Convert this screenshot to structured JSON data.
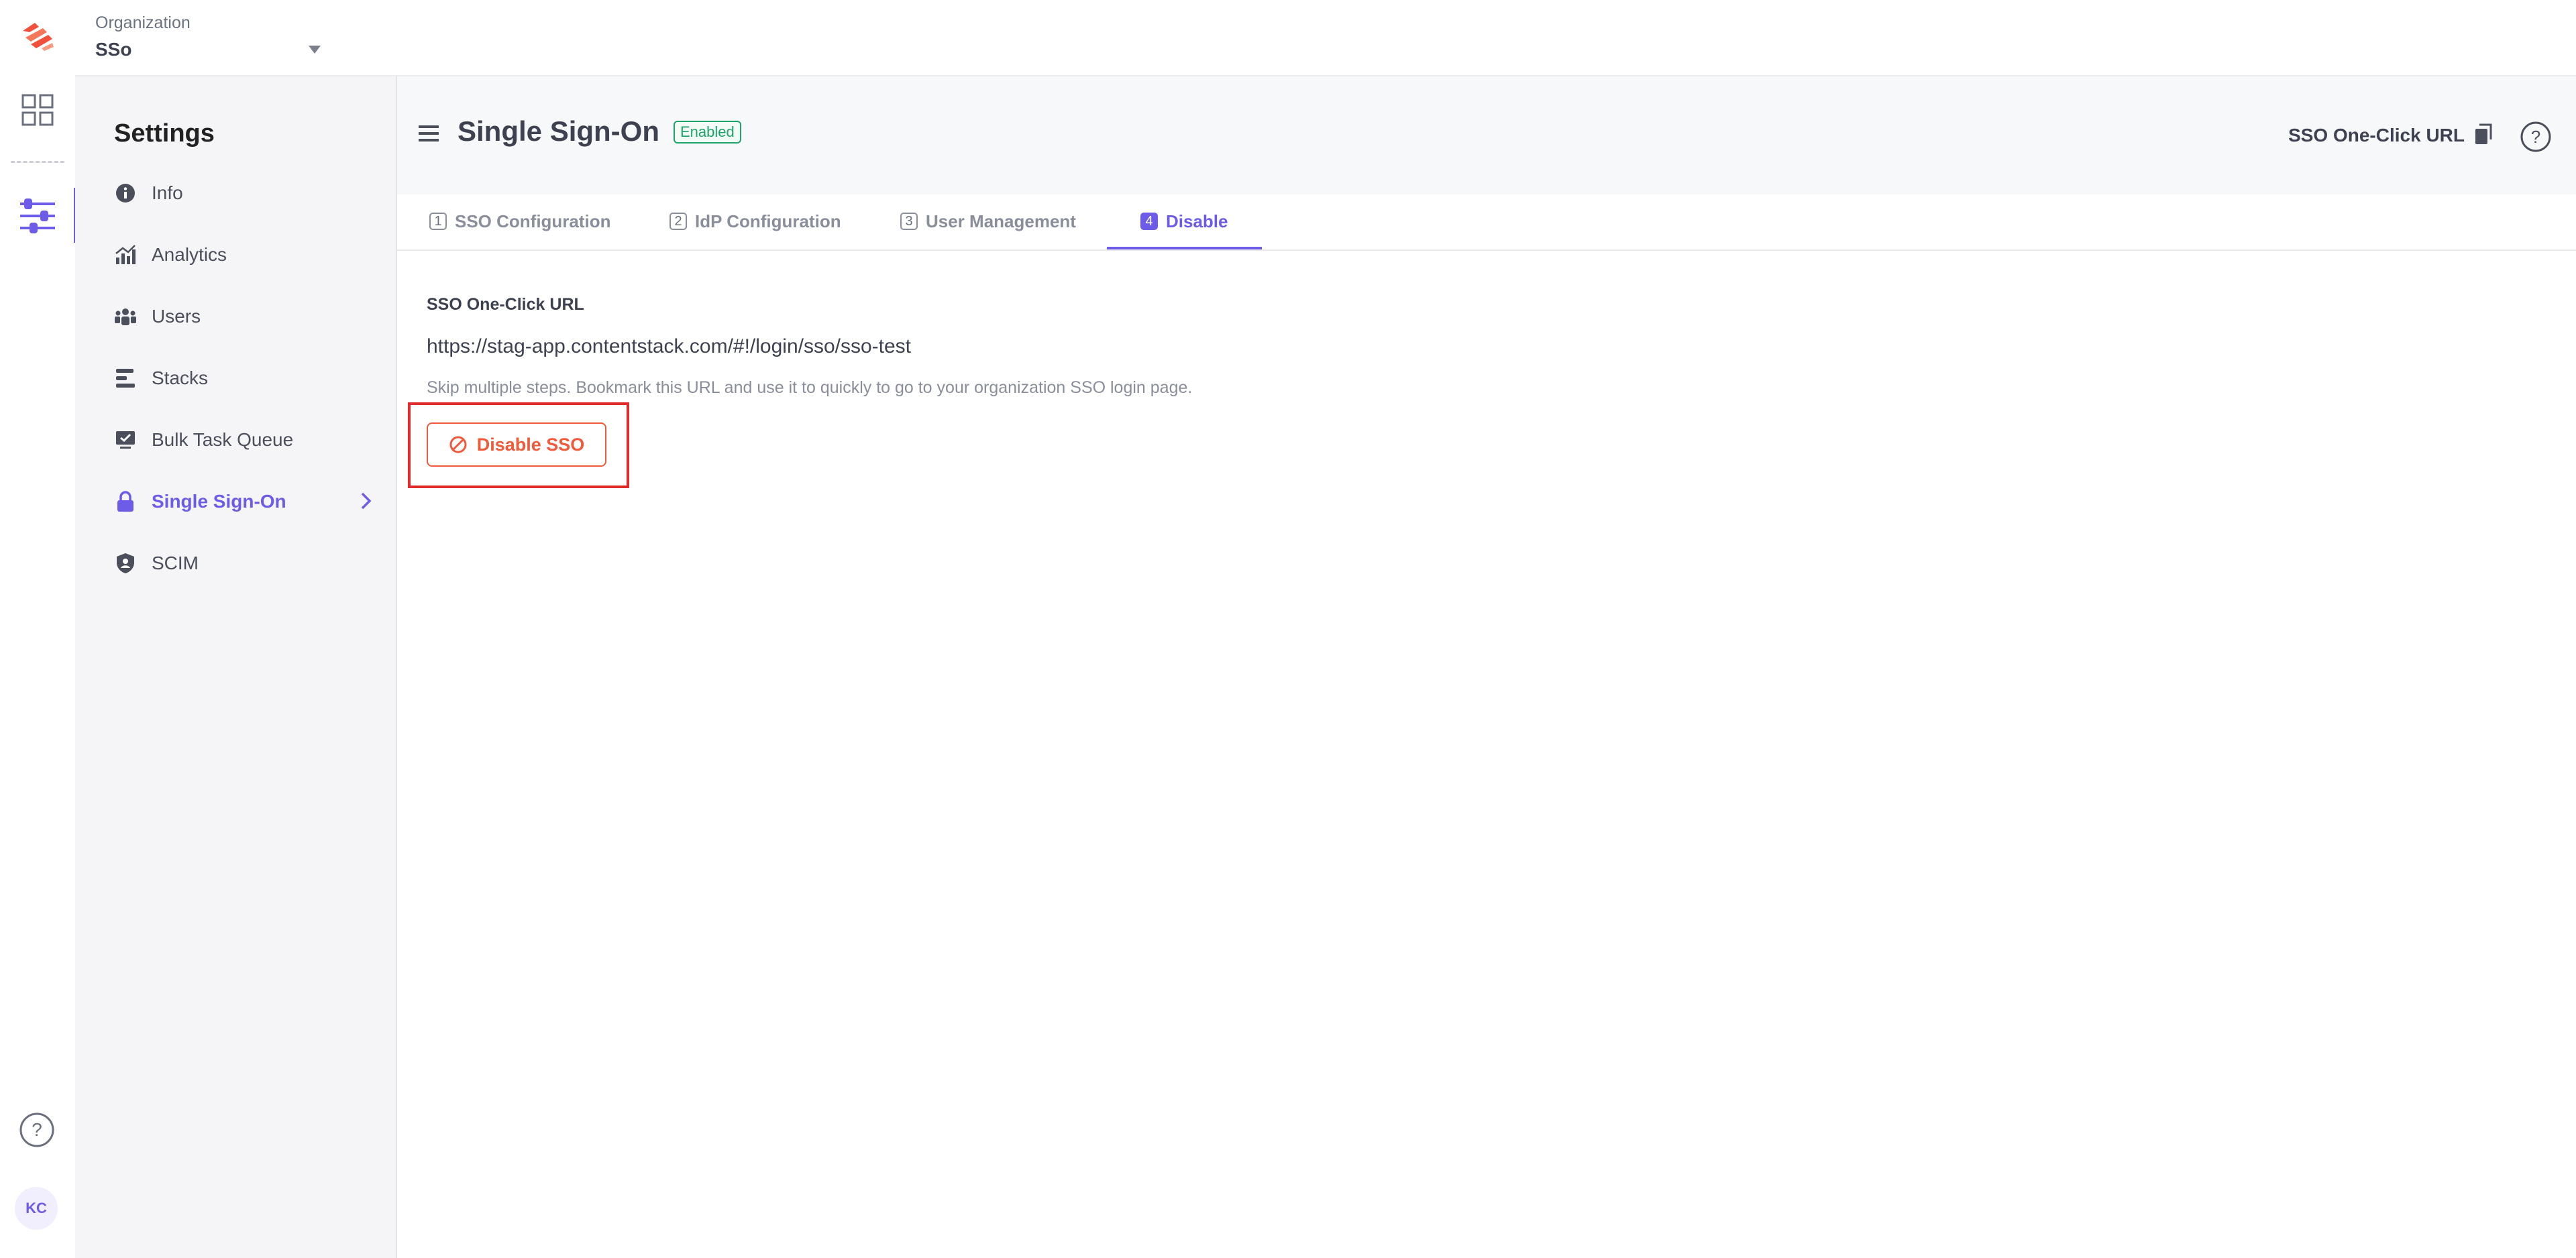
{
  "org": {
    "label": "Organization",
    "value": "SSo"
  },
  "rail": {
    "avatar_initials": "KC"
  },
  "sidebar": {
    "title": "Settings",
    "items": [
      {
        "label": "Info",
        "icon": "info-icon"
      },
      {
        "label": "Analytics",
        "icon": "analytics-icon"
      },
      {
        "label": "Users",
        "icon": "users-icon"
      },
      {
        "label": "Stacks",
        "icon": "stacks-icon"
      },
      {
        "label": "Bulk Task Queue",
        "icon": "bulk-task-icon"
      },
      {
        "label": "Single Sign-On",
        "icon": "lock-icon",
        "active": true
      },
      {
        "label": "SCIM",
        "icon": "shield-icon"
      }
    ]
  },
  "header": {
    "title": "Single Sign-On",
    "badge": "Enabled",
    "sso_url_label": "SSO One-Click URL"
  },
  "tabs": [
    {
      "num": "1",
      "label": "SSO Configuration"
    },
    {
      "num": "2",
      "label": "IdP Configuration"
    },
    {
      "num": "3",
      "label": "User Management"
    },
    {
      "num": "4",
      "label": "Disable",
      "active": true
    }
  ],
  "content": {
    "label": "SSO One-Click URL",
    "url": "https://stag-app.contentstack.com/#!/login/sso/sso-test",
    "help": "Skip multiple steps. Bookmark this URL and use it to quickly to go to your organization SSO login page.",
    "disable_button": "Disable SSO"
  },
  "colors": {
    "accent": "#6c5ce7",
    "danger": "#f05a3a",
    "success": "#1da46a",
    "logo": "#f0503c"
  }
}
